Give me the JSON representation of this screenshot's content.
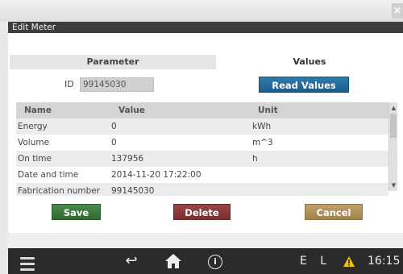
{
  "window": {
    "close_label": "×",
    "title": "Edit Meter"
  },
  "tabs": [
    {
      "label": "Parameter"
    },
    {
      "label": "Values"
    }
  ],
  "id_field": {
    "label": "ID",
    "value": "99145030"
  },
  "read_values_label": "Read Values",
  "table": {
    "headers": {
      "name": "Name",
      "value": "Value",
      "unit": "Unit"
    },
    "rows": [
      {
        "name": "Energy",
        "value": "0",
        "unit": "kWh"
      },
      {
        "name": "Volume",
        "value": "0",
        "unit": "m^3"
      },
      {
        "name": "On time",
        "value": "137956",
        "unit": "h"
      },
      {
        "name": "Date and time",
        "value": "2014-11-20 17:22:00",
        "unit": ""
      },
      {
        "name": "Fabrication number",
        "value": "99145030",
        "unit": ""
      }
    ],
    "scroll_up": "▲",
    "scroll_down": "▼"
  },
  "buttons": {
    "save": "Save",
    "delete": "Delete",
    "cancel": "Cancel"
  },
  "taskbar": {
    "back_icon": "↩",
    "info_icon": "i",
    "status_text": "E L",
    "time": "16:15",
    "warning_color": "#f5c400"
  }
}
